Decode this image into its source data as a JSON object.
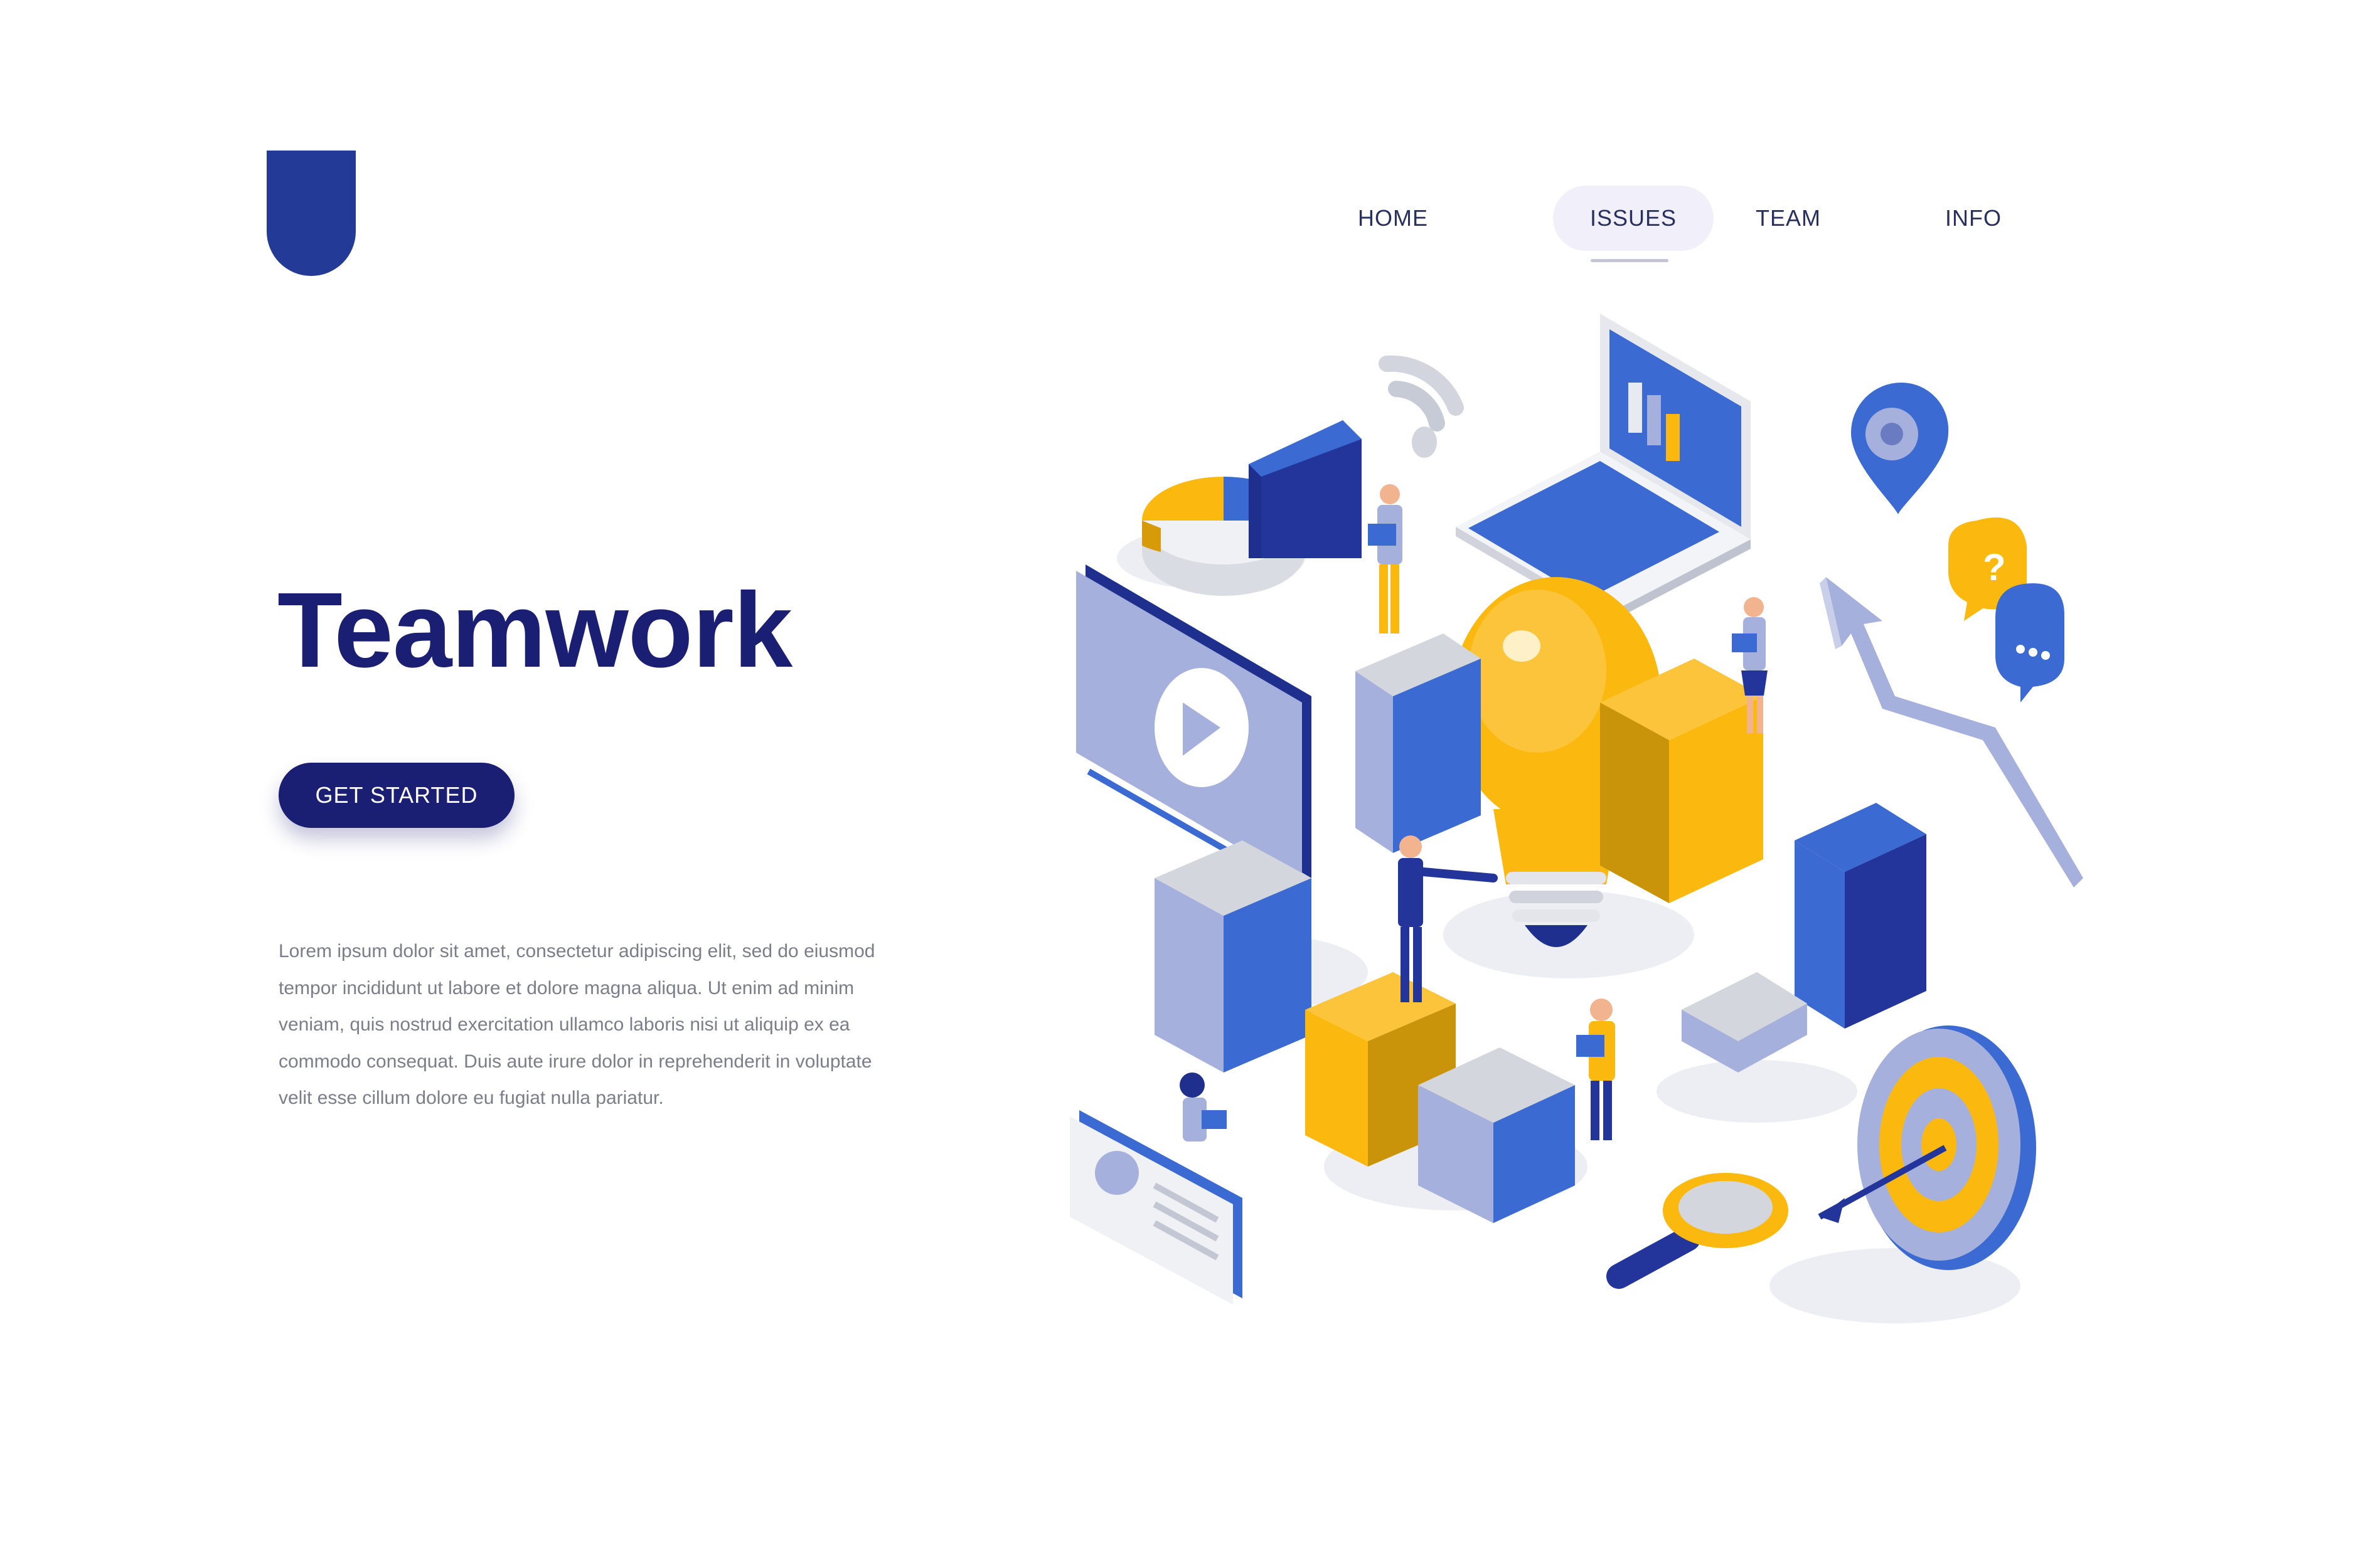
{
  "header": {
    "logo_icon": "shield-logo-icon",
    "nav": [
      {
        "label": "HOME",
        "active": false
      },
      {
        "label": "ISSUES",
        "active": true
      },
      {
        "label": "TEAM",
        "active": false
      },
      {
        "label": "INFO",
        "active": false
      }
    ]
  },
  "hero": {
    "title": "Teamwork",
    "cta_label": "GET STARTED",
    "body_lines": [
      "Lorem ipsum dolor sit amet, consectetur adipiscing elit, sed do eiusmod",
      "tempor incididunt ut labore et dolore magna aliqua. Ut enim ad minim",
      "veniam, quis nostrud exercitation ullamco laboris nisi ut aliquip ex ea",
      "commodo consequat. Duis aute irure dolor in reprehenderit in voluptate",
      "velit esse cillum dolore eu fugiat nulla pariatur."
    ]
  },
  "illustration": {
    "icons": [
      "pie-chart-icon",
      "wifi-icon",
      "laptop-icon",
      "location-pin-icon",
      "question-bubble-icon",
      "chat-bubble-icon",
      "video-player-icon",
      "light-bulb-icon",
      "puzzle-icon",
      "growth-arrow-icon",
      "magnifier-icon",
      "target-icon",
      "settings-card-icon",
      "person-icon"
    ]
  },
  "colors": {
    "brand_navy": "#1b1f73",
    "logo_blue": "#233b96",
    "accent_blue": "#3a6ad2",
    "accent_yellow": "#fbb90f",
    "light_purple": "#a6b0dc",
    "grey": "#d4d6dd",
    "nav_active_bg": "#f1effa"
  }
}
